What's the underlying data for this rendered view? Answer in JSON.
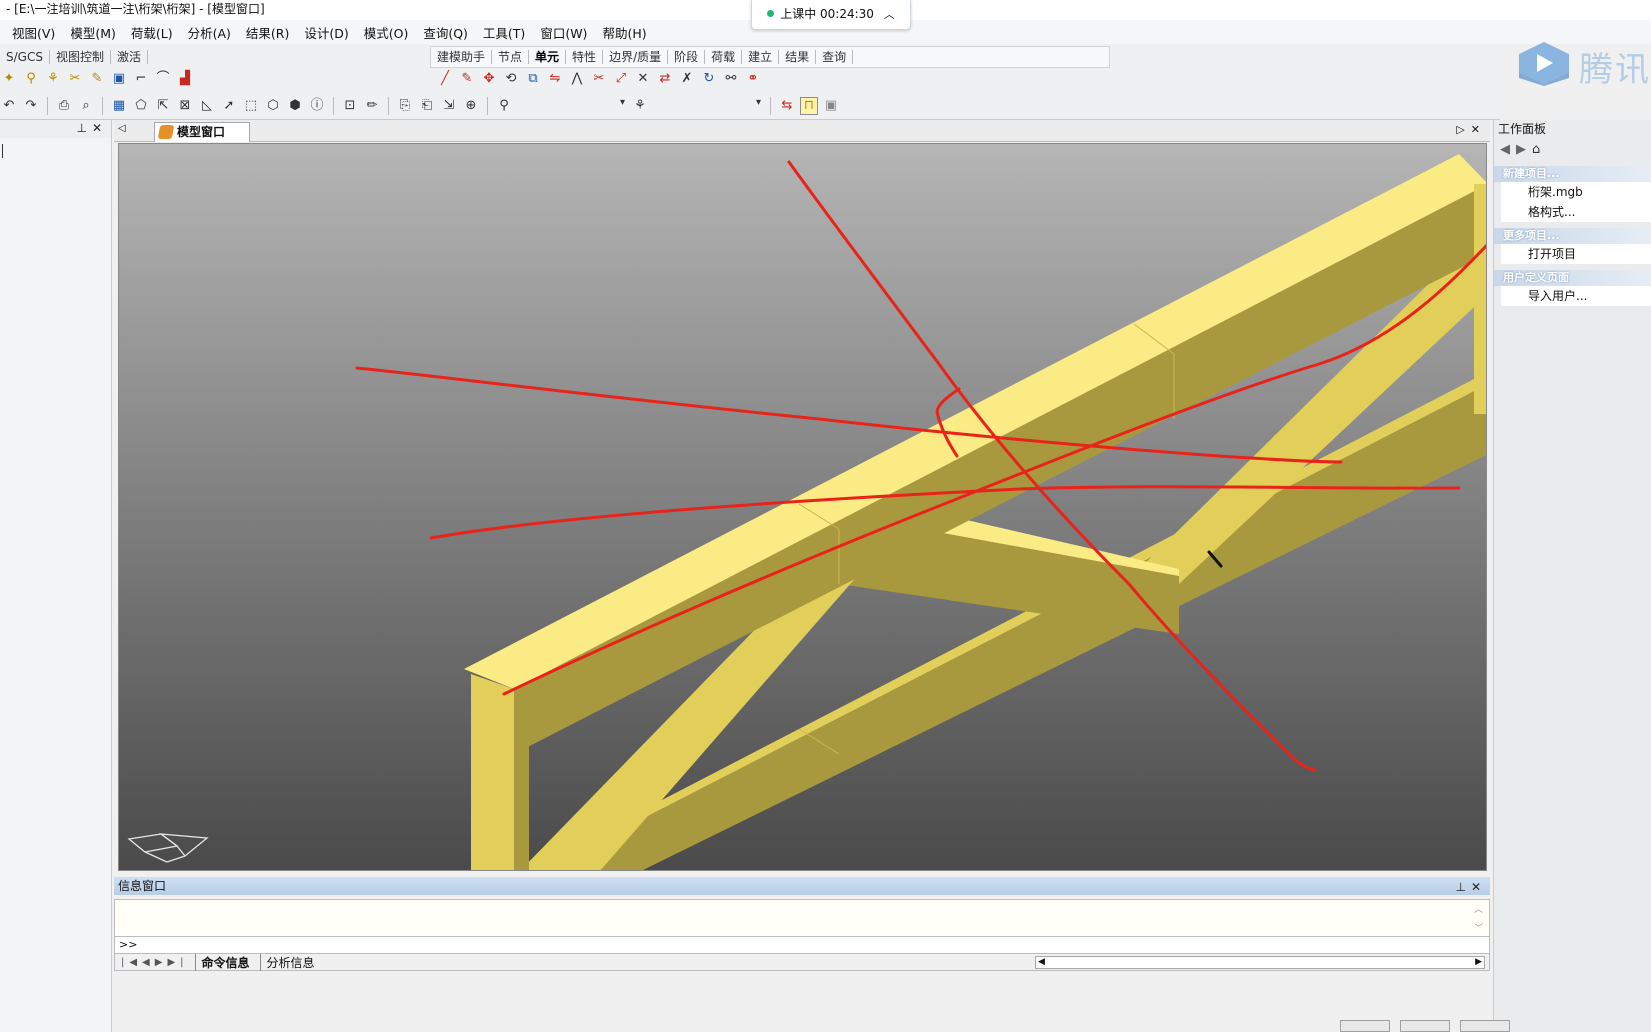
{
  "window": {
    "title": "- [E:\\一注培训\\筑道一注\\桁架\\桁架] - [模型窗口]"
  },
  "class_status": {
    "text": "上课中 00:24:30",
    "chevron": "chevron-up-icon"
  },
  "menu": [
    "视图(V)",
    "模型(M)",
    "荷载(L)",
    "分析(A)",
    "结果(R)",
    "设计(D)",
    "模式(O)",
    "查询(Q)",
    "工具(T)",
    "窗口(W)",
    "帮助(H)"
  ],
  "toolbar_left_tabs": [
    "S/GCS",
    "视图控制",
    "激活"
  ],
  "toolbar_right_tabs": [
    "建模助手",
    "节点",
    "单元",
    "特性",
    "边界/质量",
    "阶段",
    "荷载",
    "建立",
    "结果",
    "查询"
  ],
  "toolbar_right_active": "单元",
  "document": {
    "tab_label": "模型窗口"
  },
  "work_panel": {
    "title": "工作面板",
    "sections": [
      {
        "header": "新建项目...",
        "items": [
          "桁架.mgb",
          "格构式..."
        ]
      },
      {
        "header": "更多项目...",
        "items": [
          "打开项目"
        ]
      },
      {
        "header": "用户定义页面",
        "items": [
          "导入用户..."
        ]
      }
    ]
  },
  "brand": {
    "text": "腾讯"
  },
  "info_window": {
    "title": "信息窗口",
    "prompt": ">>",
    "tabs": [
      "命令信息",
      "分析信息"
    ],
    "active_tab": "命令信息"
  },
  "colors": {
    "truss_light": "#fbeb84",
    "truss_mid": "#e2cf59",
    "truss_dark": "#a8993f",
    "annotation": "#e8241a",
    "panel_accent": "#b7cde6"
  }
}
